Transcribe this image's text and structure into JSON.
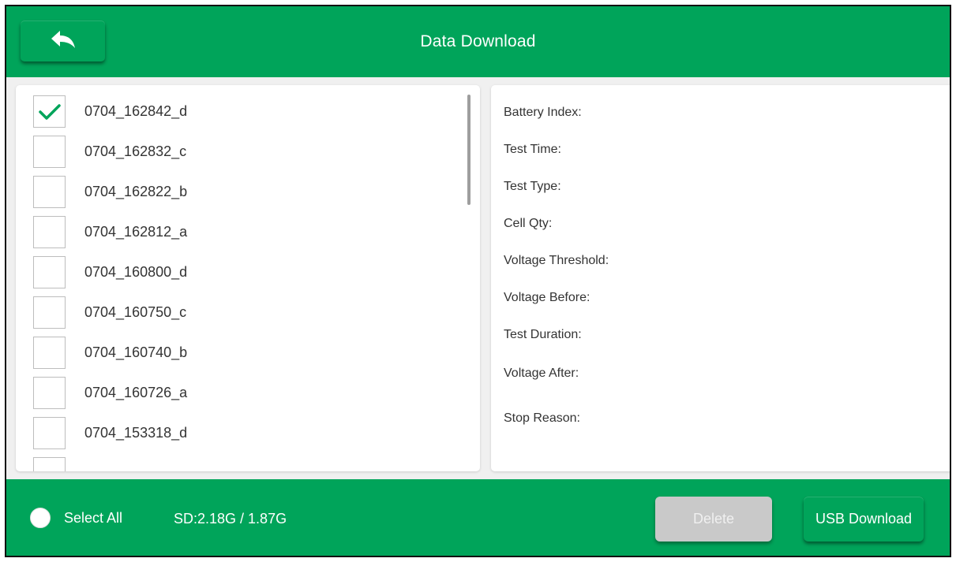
{
  "header": {
    "title": "Data Download",
    "back_icon": "back-arrow-icon"
  },
  "file_list": [
    {
      "name": "0704_162842_d",
      "checked": true
    },
    {
      "name": "0704_162832_c",
      "checked": false
    },
    {
      "name": "0704_162822_b",
      "checked": false
    },
    {
      "name": "0704_162812_a",
      "checked": false
    },
    {
      "name": "0704_160800_d",
      "checked": false
    },
    {
      "name": "0704_160750_c",
      "checked": false
    },
    {
      "name": "0704_160740_b",
      "checked": false
    },
    {
      "name": "0704_160726_a",
      "checked": false
    },
    {
      "name": "0704_153318_d",
      "checked": false
    },
    {
      "name": "",
      "checked": false
    }
  ],
  "details": {
    "battery_index": "Battery Index:",
    "test_time": "Test Time:",
    "test_type": "Test Type:",
    "cell_qty": "Cell Qty:",
    "voltage_threshold": "Voltage Threshold:",
    "voltage_before": "Voltage Before:",
    "test_duration": "Test Duration:",
    "voltage_after": "Voltage After:",
    "stop_reason": "Stop Reason:"
  },
  "footer": {
    "select_all_label": "Select All",
    "storage": "SD:2.18G / 1.87G",
    "delete_label": "Delete",
    "usb_download_label": "USB Download"
  },
  "colors": {
    "brand_green": "#00a45a",
    "disabled_gray": "#c9c9c9",
    "check_green": "#00a45a"
  }
}
